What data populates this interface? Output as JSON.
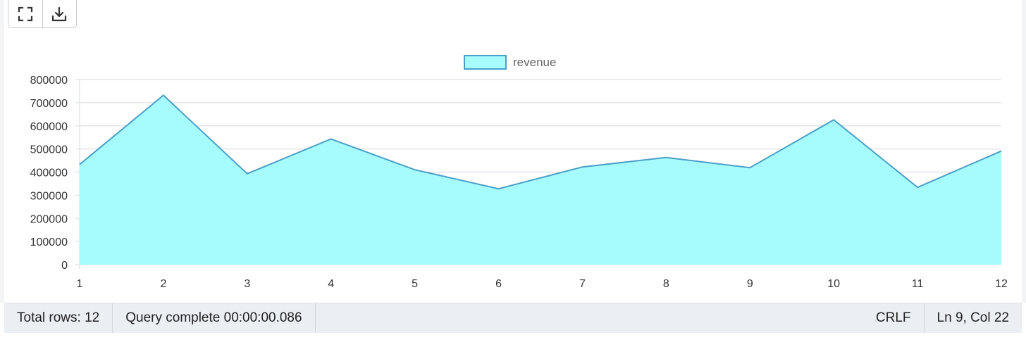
{
  "toolbar": {
    "expand_icon": "expand-icon",
    "download_icon": "download-icon"
  },
  "chart_data": {
    "type": "area",
    "x": [
      1,
      2,
      3,
      4,
      5,
      6,
      7,
      8,
      9,
      10,
      11,
      12
    ],
    "series": [
      {
        "name": "revenue",
        "values": [
          433000,
          732000,
          393000,
          543000,
          410000,
          328000,
          422000,
          463000,
          419000,
          626000,
          334000,
          491000
        ],
        "fill": "#a6fcfc",
        "stroke": "#4a9fc8"
      }
    ],
    "ylim": [
      0,
      800000
    ],
    "yticks": [
      0,
      100000,
      200000,
      300000,
      400000,
      500000,
      600000,
      700000,
      800000
    ],
    "grid": true,
    "legend": "top-center"
  },
  "status": {
    "total_rows": "Total rows: 12",
    "query_complete": "Query complete 00:00:00.086",
    "line_ending": "CRLF",
    "cursor_position": "Ln 9, Col 22"
  }
}
